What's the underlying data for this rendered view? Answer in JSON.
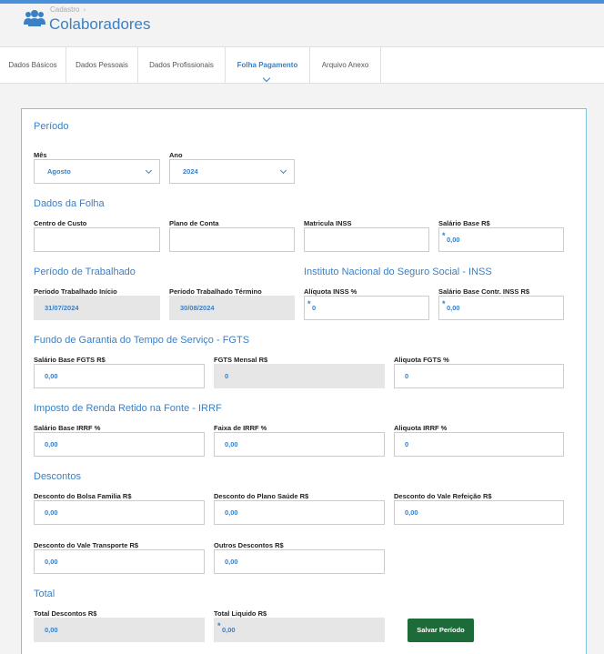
{
  "header": {
    "breadcrumb": "Cadastro",
    "title": "Colaboradores"
  },
  "tabs": [
    {
      "label": "Dados Básicos"
    },
    {
      "label": "Dados Pessoais"
    },
    {
      "label": "Dados Profissionais"
    },
    {
      "label": "Folha Pagamento",
      "active": true
    },
    {
      "label": "Arquivo Anexo"
    }
  ],
  "sections": {
    "periodo": "Período",
    "dados_folha": "Dados da Folha",
    "periodo_trabalho": "Período de Trabalhado",
    "inss": "Instituto Nacional do Seguro Social - INSS",
    "fgts": "Fundo de Garantia do Tempo de Serviço - FGTS",
    "irrf": "Imposto de Renda Retido na Fonte - IRRF",
    "descontos": "Descontos",
    "total": "Total"
  },
  "fields": {
    "mes": {
      "label": "Mês",
      "value": "Agosto"
    },
    "ano": {
      "label": "Ano",
      "value": "2024"
    },
    "centro_custo": {
      "label": "Centro de Custo",
      "value": ""
    },
    "plano_conta": {
      "label": "Plano de Conta",
      "value": ""
    },
    "matricula_inss": {
      "label": "Matricula INSS",
      "value": ""
    },
    "salario_base": {
      "label": "Salário Base R$",
      "value": "0,00"
    },
    "periodo_inicio": {
      "label": "Período Trabalhado Início",
      "value": "31/07/2024"
    },
    "periodo_termino": {
      "label": "Período Trabalhado Término",
      "value": "30/08/2024"
    },
    "aliquota_inss": {
      "label": "Alíquota INSS %",
      "value": "0"
    },
    "salario_contr_inss": {
      "label": "Salário Base Contr. INSS R$",
      "value": "0,00"
    },
    "salario_fgts": {
      "label": "Salário Base FGTS R$",
      "value": "0,00"
    },
    "fgts_mensal": {
      "label": "FGTS Mensal R$",
      "value": "0"
    },
    "aliquota_fgts": {
      "label": "Aliquota FGTS %",
      "value": "0"
    },
    "salario_irrf": {
      "label": "Salário Base IRRF %",
      "value": "0,00"
    },
    "faixa_irrf": {
      "label": "Faixa de IRRF %",
      "value": "0,00"
    },
    "aliquota_irrf": {
      "label": "Aliquota IRRF %",
      "value": "0"
    },
    "desc_bolsa": {
      "label": "Desconto do Bolsa Familia R$",
      "value": "0,00"
    },
    "desc_saude": {
      "label": "Desconto do Plano Saúde R$",
      "value": "0,00"
    },
    "desc_refeicao": {
      "label": "Desconto do Vale Refeição R$",
      "value": "0,00"
    },
    "desc_transporte": {
      "label": "Desconto do Vale Transporte R$",
      "value": "0,00"
    },
    "outros_desc": {
      "label": "Outros Descontos R$",
      "value": "0,00"
    },
    "total_desc": {
      "label": "Total Descontos R$",
      "value": "0,00"
    },
    "total_liquido": {
      "label": "Total Liquido R$",
      "value": "0,00"
    }
  },
  "actions": {
    "save_label": "Salvar Período"
  },
  "colors": {
    "accent": "#3b7fc4",
    "save_button": "#1e6b3a",
    "top_bar": "#4a90d9"
  }
}
